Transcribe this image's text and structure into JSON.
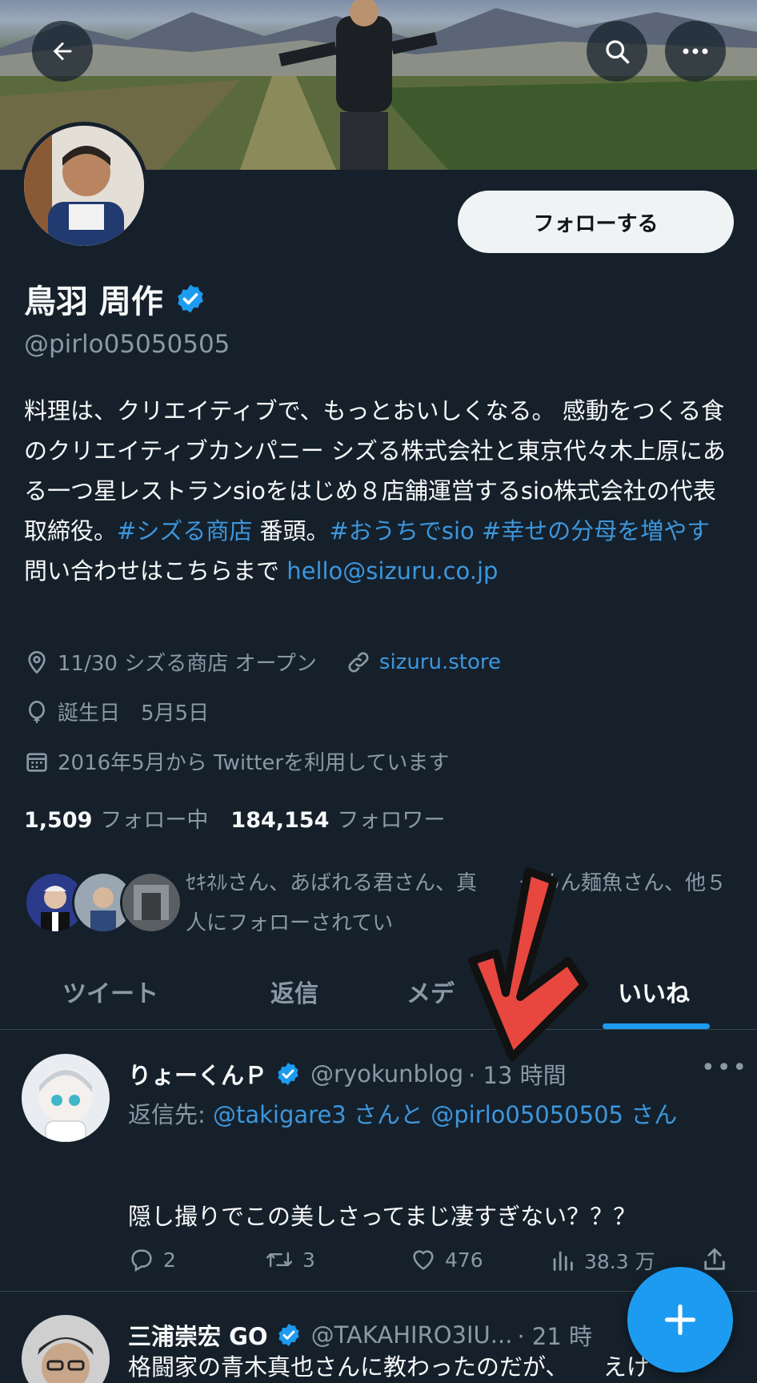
{
  "profile": {
    "name": "鳥羽 周作",
    "handle": "@pirlo05050505",
    "follow_label": "フォローする",
    "bio_parts": [
      {
        "text": "料理は、クリエイティブで、もっとおいしくなる。 感動をつくる食のクリエイティブカンパニー シズる株式会社と東京代々木上原にある一つ星レストランsioをはじめ８店舗運営するsio株式会社の代表取締役。",
        "link": false
      },
      {
        "text": "#シズる商店",
        "link": true
      },
      {
        "text": " 番頭。",
        "link": false
      },
      {
        "text": "#おうちでsio",
        "link": true
      },
      {
        "text": " ",
        "link": false
      },
      {
        "text": "#幸せの分母を増やす",
        "link": true
      },
      {
        "text": " 問い合わせはこちらまで ",
        "link": false
      },
      {
        "text": "hello@sizuru.co.jp",
        "link": true
      }
    ],
    "location": "11/30 シズる商店 オープン",
    "website": "sizuru.store",
    "birthday": "誕生日　5月5日",
    "joined": "2016年5月から Twitterを利用しています",
    "following_count": "1,509",
    "following_label": "フォロー中",
    "followers_count": "184,154",
    "followers_label": "フォロワー",
    "followed_by": "ｾｷﾈﾙさん、あばれる君さん、真　　ーめん麺魚さん、他５人にフォローされてい"
  },
  "tabs": [
    {
      "label": "ツイート",
      "active": false
    },
    {
      "label": "返信",
      "active": false
    },
    {
      "label": "メデ",
      "active": false
    },
    {
      "label": "いいね",
      "active": true
    }
  ],
  "tweets": [
    {
      "name": "りょーくんＰ",
      "handle": "@ryokunblog",
      "time": "· 13 時間",
      "reply_prefix": "返信先: ",
      "reply_to_1": "@takigare3",
      "reply_mid": " さんと ",
      "reply_to_2": "@pirlo05050505",
      "reply_suffix": " さん",
      "text": "隠し撮りでこの美しさってまじ凄すぎない？？？",
      "replies": "2",
      "retweets": "3",
      "likes": "476",
      "views": "38.3 万"
    },
    {
      "name": "三浦崇宏 GO",
      "handle": "@TAKAHIRO3IU...",
      "time": "· 21 時",
      "text": "格闘家の青木真也さんに教わったのだが、　　えけ"
    }
  ],
  "colors": {
    "background": "#15202b",
    "accent": "#1d9bf0",
    "link": "#3d96dc",
    "muted": "#8b98a5",
    "annotation_arrow": "#e8473f"
  }
}
